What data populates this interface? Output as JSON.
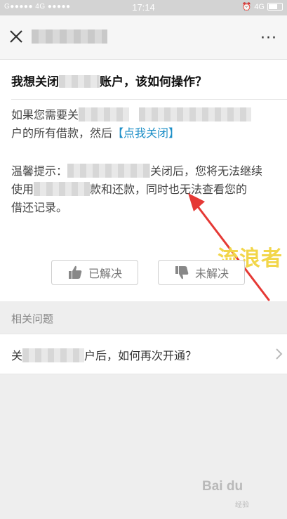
{
  "status_bar": {
    "carrier": "G●●●●● 4G ●●●●●",
    "time": "17:14",
    "network": "4G"
  },
  "nav": {
    "close_icon": "close-icon",
    "more_icon": "more-icon",
    "more_label": "···"
  },
  "question": {
    "title_part1": "我想关闭",
    "title_part2": "账户，该如何操作？"
  },
  "answer": {
    "p1_part1": "如果您需要关",
    "p1_part2": "户的所有借款，然后",
    "p1_link": "【点我关闭】",
    "p2_part1": "温馨提示：",
    "p2_part2": "关闭后，您将无法继续",
    "p2_part3": "使用",
    "p2_part4": "款和还款，同时也无法查看您的",
    "p2_part5": "借还记录。"
  },
  "feedback": {
    "solved_label": "已解决",
    "unsolved_label": "未解决"
  },
  "watermark": "流浪者",
  "related": {
    "header": "相关问题",
    "items": [
      {
        "part1": "关",
        "part2": "户后，如何再次开通？"
      }
    ]
  },
  "footer": {
    "brand": "Bai du",
    "sub": "经验"
  },
  "colors": {
    "link": "#1d8fc7",
    "arrow": "#e53935",
    "watermark": "#f2d64a"
  }
}
